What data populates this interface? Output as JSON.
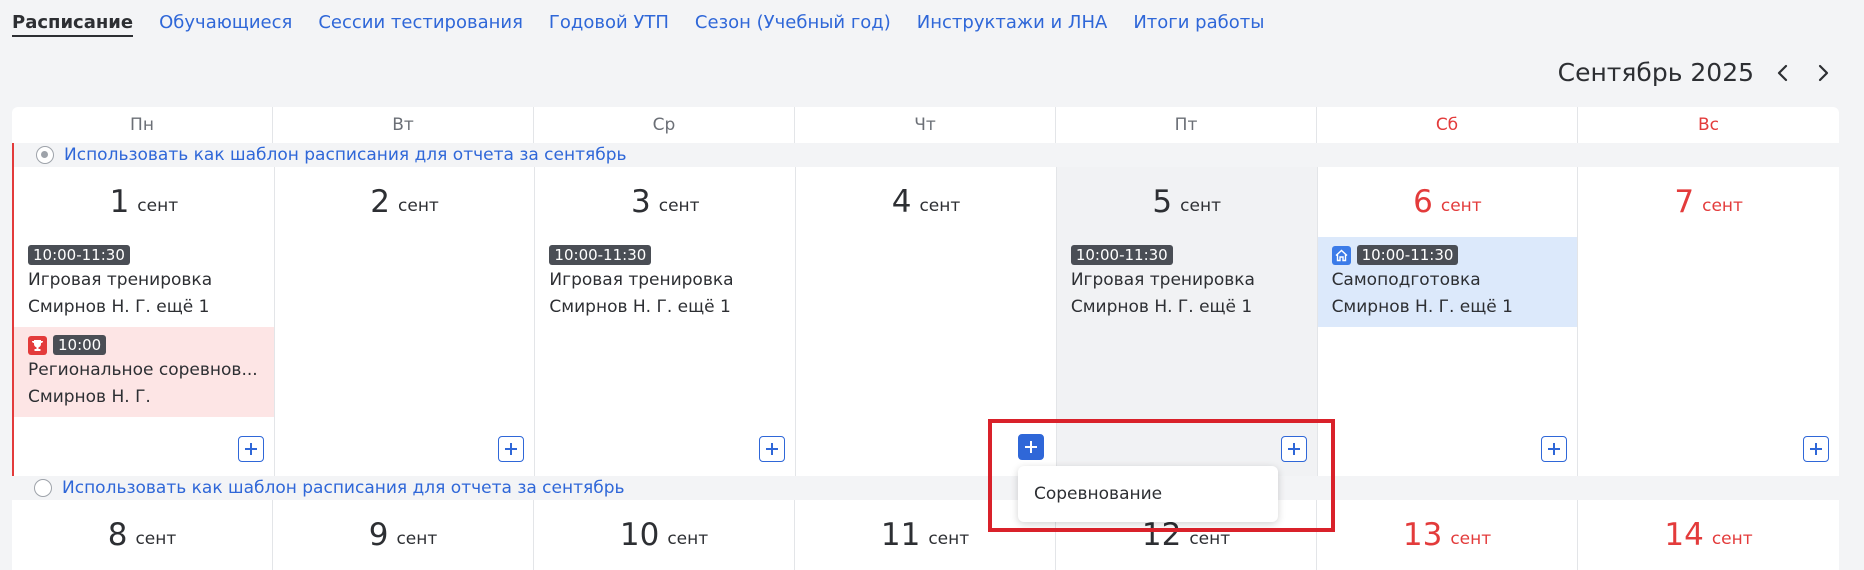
{
  "tabs": [
    {
      "label": "Расписание",
      "active": true
    },
    {
      "label": "Обучающиеся"
    },
    {
      "label": "Сессии тестирования"
    },
    {
      "label": "Годовой УТП"
    },
    {
      "label": "Сезон (Учебный год)"
    },
    {
      "label": "Инструктажи и ЛНА"
    },
    {
      "label": "Итоги работы"
    }
  ],
  "month_title": "Сентябрь 2025",
  "weekdays": [
    "Пн",
    "Вт",
    "Ср",
    "Чт",
    "Пт",
    "Сб",
    "Вс"
  ],
  "week1": {
    "template_label": "Использовать как шаблон расписания для отчета за сентябрь",
    "days": [
      {
        "num": "1",
        "mon": "сент"
      },
      {
        "num": "2",
        "mon": "сент"
      },
      {
        "num": "3",
        "mon": "сент"
      },
      {
        "num": "4",
        "mon": "сент"
      },
      {
        "num": "5",
        "mon": "сент"
      },
      {
        "num": "6",
        "mon": "сент"
      },
      {
        "num": "7",
        "mon": "сент"
      }
    ]
  },
  "week2": {
    "template_label": "Использовать как шаблон расписания для отчета за сентябрь",
    "days": [
      {
        "num": "8",
        "mon": "сент"
      },
      {
        "num": "9",
        "mon": "сент"
      },
      {
        "num": "10",
        "mon": "сент"
      },
      {
        "num": "11",
        "mon": "сент"
      },
      {
        "num": "12",
        "mon": "сент"
      },
      {
        "num": "13",
        "mon": "сент"
      },
      {
        "num": "14",
        "mon": "сент"
      }
    ]
  },
  "events": {
    "training_time": "10:00-11:30",
    "training_title": "Игровая тренировка",
    "training_who": "Смирнов Н. Г. ещё 1",
    "comp_time": "10:00",
    "comp_title": "Региональное соревнов...",
    "comp_who": "Смирнов Н. Г.",
    "self_time": "10:00-11:30",
    "self_title": "Самоподготовка",
    "self_who": "Смирнов Н. Г. ещё 1"
  },
  "dropdown": {
    "item": "Соревнование"
  },
  "colors": {
    "accent": "#2f67d8",
    "weekend": "#e33b3b",
    "highlight": "#d9212a"
  }
}
